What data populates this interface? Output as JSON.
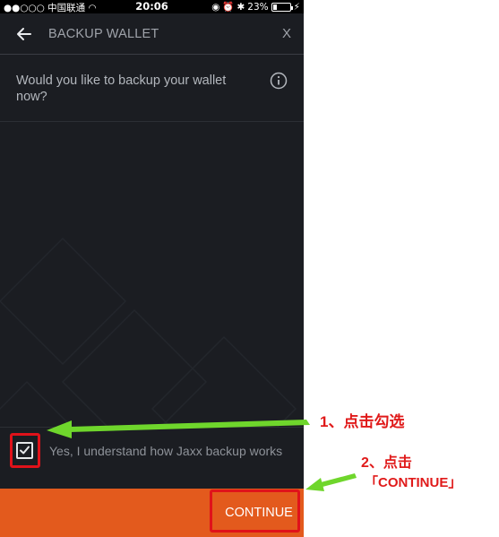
{
  "status_bar": {
    "carrier": "●●○○○ 中国联通",
    "time": "20:06",
    "battery_percent_text": "23%",
    "battery_level": 0.23
  },
  "header": {
    "title": "BACKUP WALLET",
    "close_label": "X"
  },
  "main": {
    "question": "Would you like to backup your wallet now?"
  },
  "checkbox": {
    "label": "Yes, I understand how Jaxx backup works",
    "checked": true
  },
  "footer": {
    "continue_label": "CONTINUE"
  },
  "annotations": {
    "step1": "1、点击勾选",
    "step2_line1": "2、点击",
    "step2_line2": "「CONTINUE」"
  },
  "colors": {
    "background": "#1b1d22",
    "accent_orange": "#e35a1d",
    "annotation_red": "#e0121a",
    "annotation_green": "#6fd62c"
  }
}
